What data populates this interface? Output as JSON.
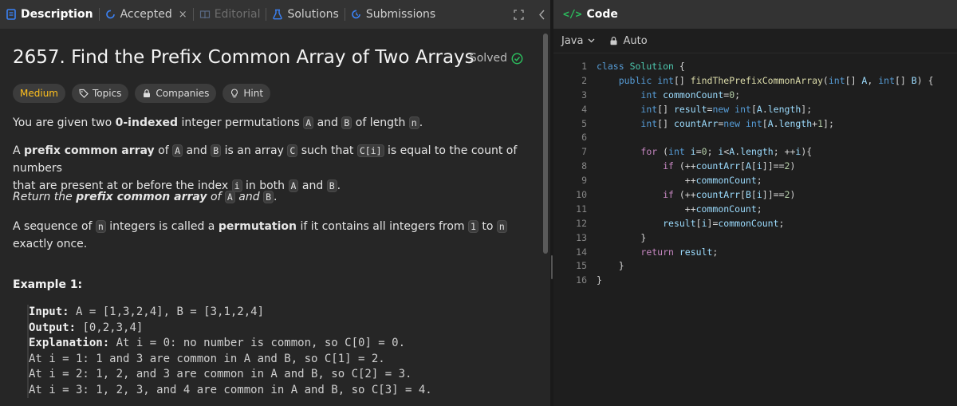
{
  "tabs": {
    "description": "Description",
    "accepted": "Accepted",
    "close": "×",
    "editorial": "Editorial",
    "solutions": "Solutions",
    "submissions": "Submissions"
  },
  "problem": {
    "title": "2657. Find the Prefix Common Array of Two Arrays",
    "solved": "Solved",
    "difficulty": "Medium",
    "topics": "Topics",
    "companies": "Companies",
    "hint": "Hint",
    "p1": {
      "a": "You are given two ",
      "b": "0-indexed",
      "c": " integer permutations ",
      "d": "A",
      "e": " and ",
      "f": "B",
      "g": " of length ",
      "h": "n",
      "i": "."
    },
    "p2": {
      "a": "A ",
      "b": "prefix common array",
      "c": " of ",
      "d": "A",
      "e": " and ",
      "f": "B",
      "g": " is an array ",
      "h": "C",
      "i": " such that ",
      "j": "C[i]",
      "k": " is equal to the count of numbers",
      "l": "that are present at or before the index ",
      "m": "i",
      "n": " in both ",
      "o": "A",
      "p": " and ",
      "q": "B",
      "r": "."
    },
    "p3": {
      "a": "Return the ",
      "b": "prefix common array",
      "c": " of ",
      "d": "A",
      "e": " and ",
      "f": "B",
      "g": "."
    },
    "p4": {
      "a": "A sequence of ",
      "b": "n",
      "c": " integers is called a ",
      "d": "permutation",
      "e": " if it contains all integers from ",
      "f": "1",
      "g": " to ",
      "h": "n",
      "i": " exactly once."
    },
    "example_title": "Example 1:",
    "example": {
      "input_label": "Input:",
      "input": " A = [1,3,2,4], B = [3,1,2,4]",
      "output_label": "Output:",
      "output": " [0,2,3,4]",
      "explanation_label": "Explanation:",
      "explanation": " At i = 0: no number is common, so C[0] = 0.",
      "line2": "At i = 1: 1 and 3 are common in A and B, so C[1] = 2.",
      "line3": "At i = 2: 1, 2, and 3 are common in A and B, so C[2] = 3.",
      "line4": "At i = 3: 1, 2, 3, and 4 are common in A and B, so C[3] = 4."
    }
  },
  "editor": {
    "header": "Code",
    "language": "Java",
    "mode": "Auto",
    "line_numbers": [
      "1",
      "2",
      "3",
      "4",
      "5",
      "6",
      "7",
      "8",
      "9",
      "10",
      "11",
      "12",
      "13",
      "14",
      "15",
      "16"
    ]
  },
  "colors": {
    "accent_green": "#2cbb5d",
    "medium": "#ffc01e"
  }
}
